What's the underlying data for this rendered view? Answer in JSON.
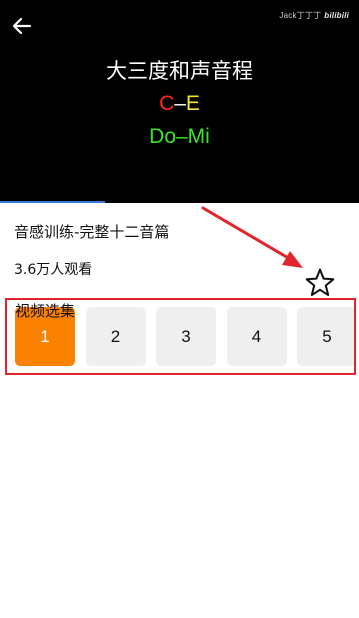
{
  "video": {
    "line1": "大三度和声音程",
    "line2": {
      "left": "C",
      "dash": "–",
      "right": "E"
    },
    "line3": "Do–Mi",
    "watermark_user": "Jack丁丁丁",
    "watermark_brand": "bilibili",
    "back_icon": "arrow-left-icon",
    "colors": {
      "left_note": "#ff2a1c",
      "right_note": "#f4e52a",
      "solfege": "#38e628"
    }
  },
  "info": {
    "title": "音感训练-完整十二音篇",
    "views": "3.6万人观看",
    "favorite_icon": "star-outline-icon"
  },
  "episodes": {
    "label": "视频选集",
    "items": [
      "1",
      "2",
      "3",
      "4",
      "5"
    ],
    "selected": "1",
    "accent": "#fb8200",
    "border_color": "#e0252c"
  }
}
